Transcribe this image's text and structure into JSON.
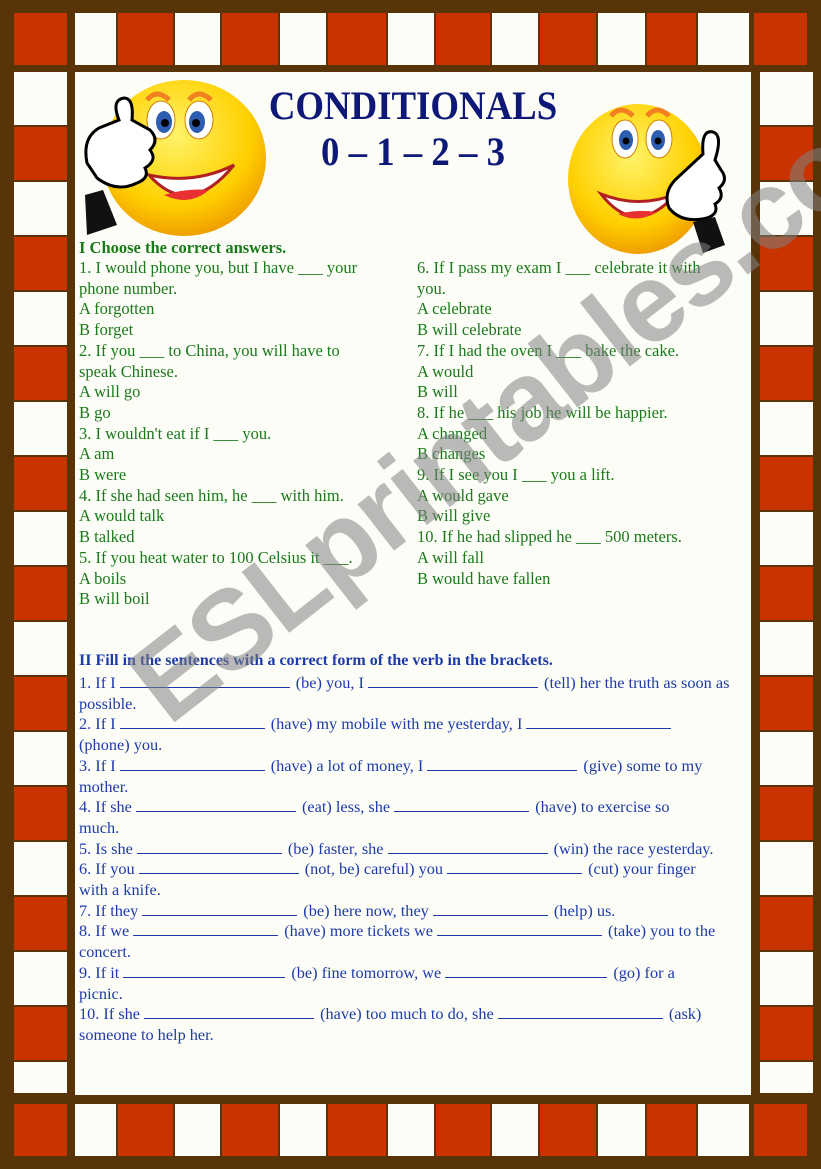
{
  "header": {
    "title": "CONDITIONALS",
    "subtitle": "0 – 1 – 2 – 3"
  },
  "colors": {
    "border_brown": "#5a3409",
    "tile_red": "#c83300",
    "tile_white": "#fdfdf8",
    "title_navy": "#0d1877",
    "section1_green": "#1a7a1a",
    "section2_blue": "#1d3aa8"
  },
  "icons": {
    "left": "thumbs-up-smiley-icon",
    "right": "thumbs-up-smiley-icon"
  },
  "section1": {
    "heading": "I Choose the correct answers.",
    "left_column": [
      "1. I would phone you, but I have ___ your",
      "phone number.",
      "A forgotten",
      "B forget",
      "2. If you ___  to China, you will have to",
      "speak Chinese.",
      "A will go",
      "B go",
      "3. I wouldn't eat if I ___ you.",
      "A am",
      "B were",
      "4. If she had seen him, he ___ with him.",
      "A would talk",
      "B talked",
      "5. If you heat water to 100 Celsius it ___.",
      "A boils",
      "B will boil"
    ],
    "right_column": [
      "6. If I pass my exam I ___ celebrate it with",
      "you.",
      "A celebrate",
      "B will celebrate",
      "7. If I had the oven I ___ bake the cake.",
      "A would",
      "B will",
      "8. If he ___ his job he will be happier.",
      "A changed",
      "B changes",
      "9. If I see you I ___ you a lift.",
      "A would gave",
      "B will give",
      "10. If he had slipped he ___ 500 meters.",
      "A will fall",
      "B would have fallen"
    ]
  },
  "section2": {
    "heading": "II Fill in the sentences with a correct form of the verb in the brackets.",
    "items": [
      {
        "parts": [
          "1. If I ",
          "(be) you, I ",
          "(tell) her the truth as soon as"
        ],
        "cont": "possible.",
        "blanks": [
          170,
          170
        ]
      },
      {
        "parts": [
          "2. If I ",
          "(have) my mobile with me yesterday, I ",
          ""
        ],
        "cont": "(phone) you.",
        "blanks": [
          145,
          145
        ]
      },
      {
        "parts": [
          "3. If I ",
          "(have) a lot of money, I ",
          "(give) some to my"
        ],
        "cont": "mother.",
        "blanks": [
          145,
          150
        ]
      },
      {
        "parts": [
          "4. If she ",
          "(eat) less, she ",
          "(have) to exercise so"
        ],
        "cont": "much.",
        "blanks": [
          160,
          135
        ]
      },
      {
        "parts": [
          "5. Is she ",
          "(be) faster, she ",
          "(win) the race yesterday."
        ],
        "cont": "",
        "blanks": [
          145,
          160
        ]
      },
      {
        "parts": [
          "6. If you ",
          "(not, be) careful) you ",
          "(cut) your finger"
        ],
        "cont": "with a knife.",
        "blanks": [
          160,
          135
        ]
      },
      {
        "parts": [
          "7. If they ",
          "(be) here now, they ",
          "(help) us."
        ],
        "cont": "",
        "blanks": [
          155,
          115
        ]
      },
      {
        "parts": [
          "8. If we ",
          "(have) more tickets we ",
          "(take) you to the"
        ],
        "cont": "concert.",
        "blanks": [
          145,
          165
        ]
      },
      {
        "parts": [
          "9. If it ",
          "(be) fine tomorrow, we ",
          "(go) for a"
        ],
        "cont": "picnic.",
        "blanks": [
          162,
          162
        ]
      },
      {
        "parts": [
          "10. If she ",
          "(have) too much to do, she ",
          "(ask)"
        ],
        "cont": "someone to help her.",
        "blanks": [
          170,
          165
        ]
      }
    ]
  },
  "watermark": "ESLprintables.com"
}
